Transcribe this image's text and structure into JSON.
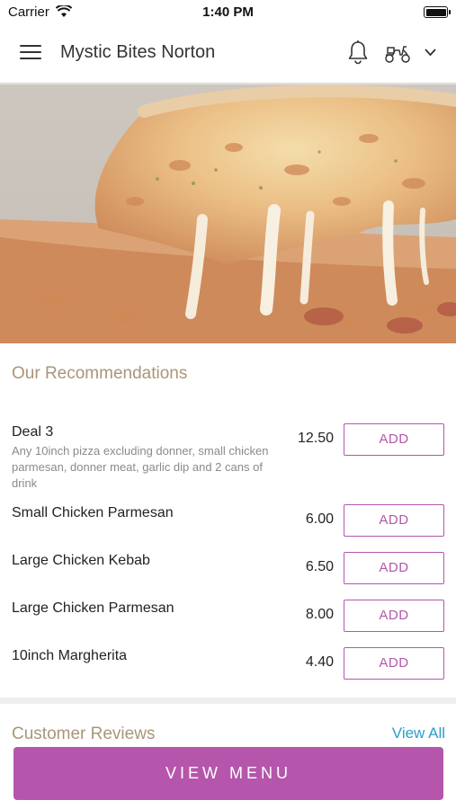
{
  "status_bar": {
    "carrier": "Carrier",
    "time": "1:40 PM",
    "icons": [
      "wifi-icon",
      "battery-icon"
    ]
  },
  "header": {
    "title": "Mystic Bites Norton",
    "icons": [
      "hamburger-menu-icon",
      "bell-icon",
      "delivery-scooter-icon",
      "chevron-down-icon"
    ]
  },
  "hero": {
    "image": "cheese-pizza-slice"
  },
  "recommendations": {
    "title": "Our Recommendations",
    "add_label": "ADD",
    "items": [
      {
        "name": "Deal 3",
        "description": "Any 10inch pizza excluding donner, small chicken parmesan, donner meat, garlic dip and 2 cans of drink",
        "price": "12.50"
      },
      {
        "name": "Small Chicken Parmesan",
        "description": "",
        "price": "6.00"
      },
      {
        "name": "Large Chicken Kebab",
        "description": "",
        "price": "6.50"
      },
      {
        "name": "Large Chicken Parmesan",
        "description": "",
        "price": "8.00"
      },
      {
        "name": "10inch Margherita",
        "description": "",
        "price": "4.40"
      }
    ]
  },
  "reviews": {
    "title": "Customer Reviews",
    "view_all_label": "View All"
  },
  "footer": {
    "view_menu_label": "VIEW MENU"
  },
  "colors": {
    "accent": "#b556ac",
    "section_title": "#a89678",
    "link": "#2a9fc4"
  }
}
